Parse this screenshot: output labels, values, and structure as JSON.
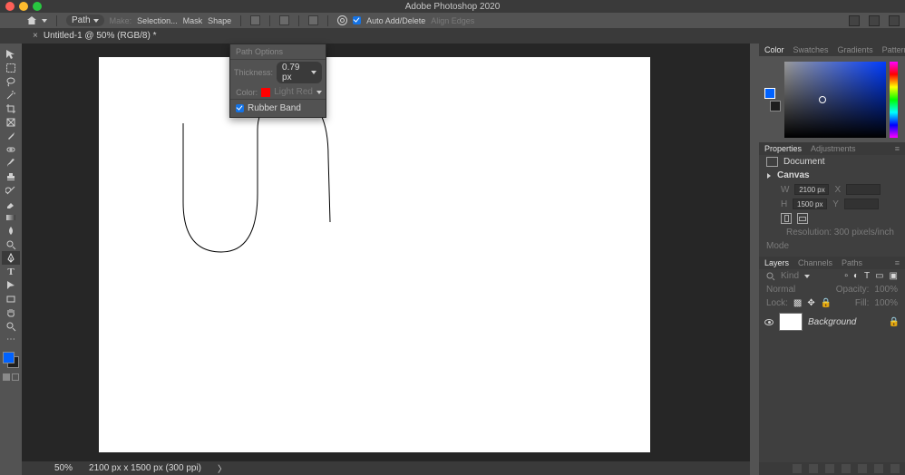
{
  "app": {
    "title": "Adobe Photoshop 2020"
  },
  "doc_tab": {
    "close": "×",
    "title": "Untitled-1 @ 50% (RGB/8) *"
  },
  "optbar": {
    "pick": "Path",
    "make_label": "Make:",
    "selection": "Selection...",
    "mask": "Mask",
    "shape": "Shape",
    "auto": "Auto Add/Delete",
    "align": "Align Edges"
  },
  "path_options": {
    "title": "Path Options",
    "thickness_label": "Thickness:",
    "thickness_value": "0.79 px",
    "color_label": "Color:",
    "color_name": "Light Red",
    "rubber_band": "Rubber Band"
  },
  "status": {
    "zoom": "50%",
    "doc": "2100 px x 1500 px (300 ppi)",
    "caret": "〉"
  },
  "color_tabs": [
    "Color",
    "Swatches",
    "Gradients",
    "Patterns"
  ],
  "properties": {
    "tab_props": "Properties",
    "tab_adj": "Adjustments",
    "doc": "Document",
    "canvas": "Canvas",
    "w": "W",
    "w_val": "2100 px",
    "x": "X",
    "h": "H",
    "h_val": "1500 px",
    "y": "Y",
    "res": "Resolution: 300 pixels/inch",
    "mode": "Mode"
  },
  "layers": {
    "tabs": [
      "Layers",
      "Channels",
      "Paths"
    ],
    "kind": "Kind",
    "blend": "Normal",
    "opacity_label": "Opacity:",
    "opacity_val": "100%",
    "lock": "Lock:",
    "fill_label": "Fill:",
    "fill_val": "100%",
    "layer": "Background"
  }
}
